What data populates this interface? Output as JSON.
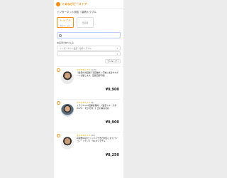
{
  "header": {
    "logo": "ぐるなびビーストア"
  },
  "breadcrumb": "インターネット設定・接続トラブル",
  "tabs": [
    {
      "label": "トラブル",
      "sub": "解決サービス"
    },
    {
      "label": "出品者",
      "sub": ""
    }
  ],
  "search": {
    "placeholder": ""
  },
  "hint": "",
  "filters": [
    {
      "label": "出品者の絞り込み",
      "value": ""
    },
    {
      "label": "",
      "value": "インターネット設定・接続トラブル"
    },
    {
      "label": "",
      "value": ""
    }
  ],
  "sort": {
    "label": "ランキング"
  },
  "cards": [
    {
      "rating": "★★★★★ 4.9",
      "count": "(125)",
      "title": "【最安の光回線】初回無料＋午後に当日やサポート診断します。回答回答可能！",
      "meta": "",
      "price": "¥9,900"
    },
    {
      "rating": "★★★★★ 4.9",
      "count": "(8)",
      "title": "トラブル→12回解析無料！【最安トキ・大手Wi-Fi】 【日3万件！】合わ解決対応",
      "meta": "",
      "price": "¥9,900"
    },
    {
      "rating": "★★★★★ 4.8",
      "count": "(62)",
      "title": "初期費0円のエンジニアが当日対応し全てパソコン・リモンド・Wi-Fiトラブル",
      "meta": "",
      "price": "¥8,250"
    }
  ]
}
